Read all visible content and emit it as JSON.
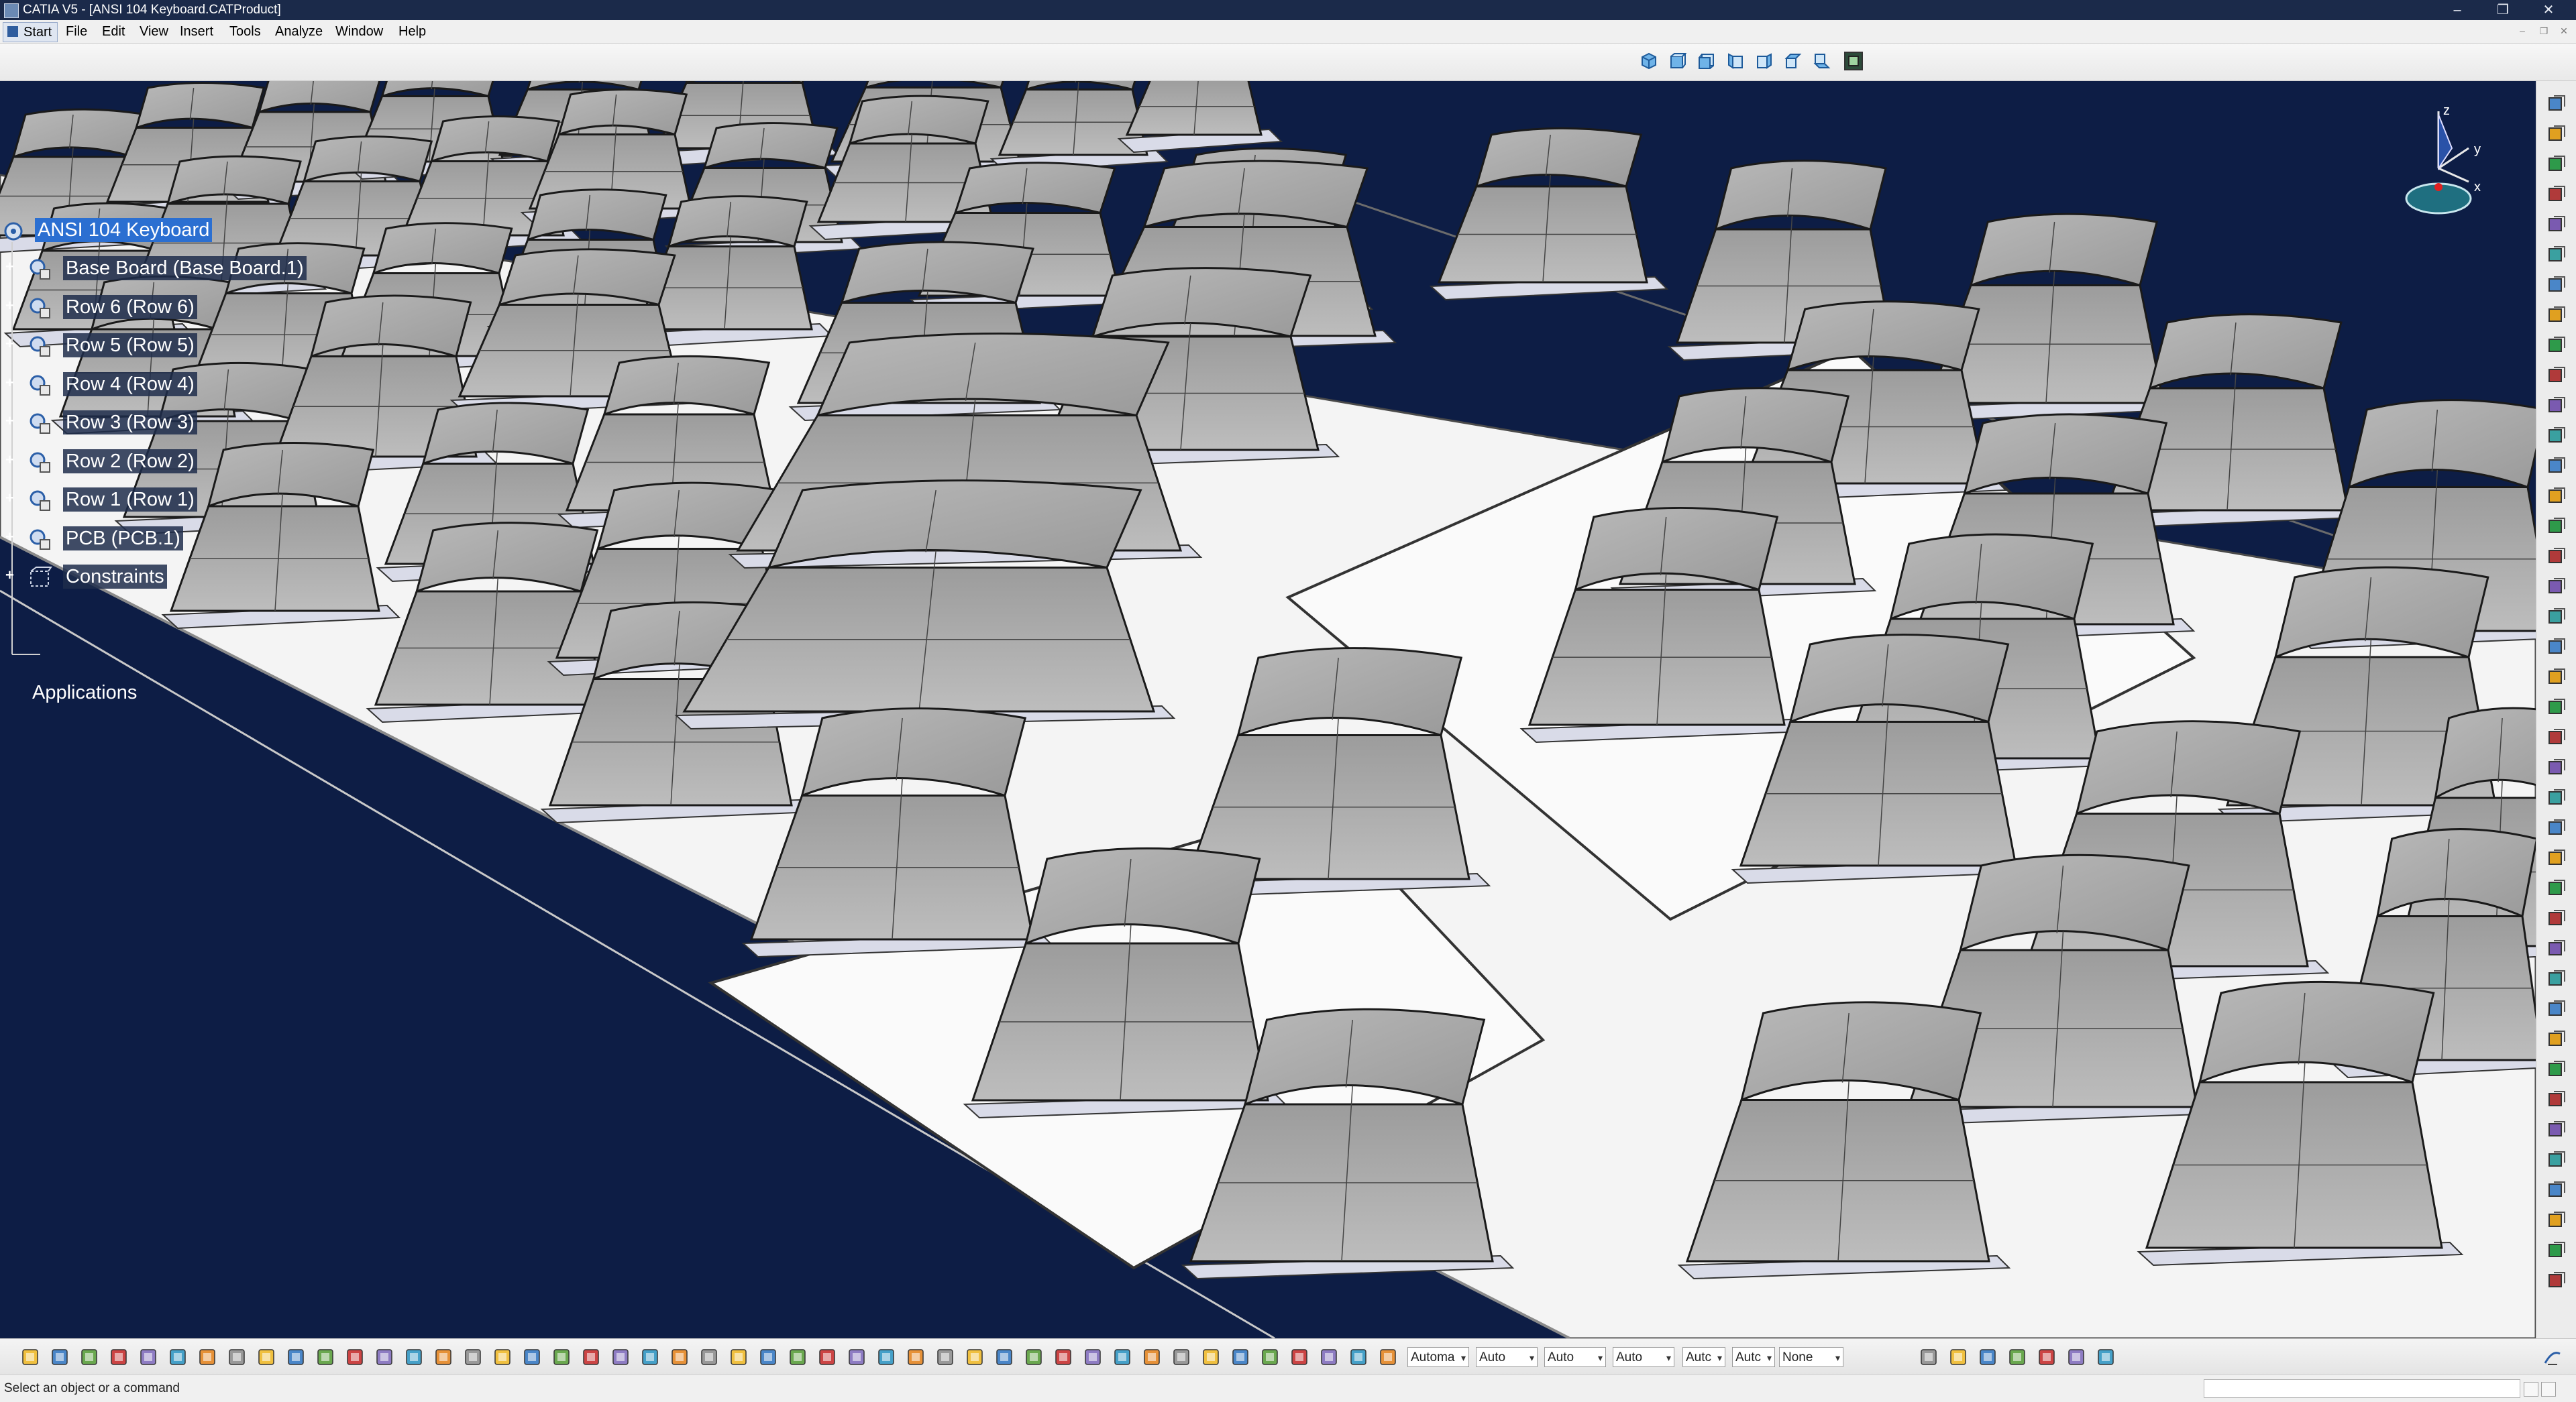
{
  "window": {
    "title": "CATIA V5 - [ANSI 104 Keyboard.CATProduct]",
    "controls": [
      "–",
      "❐",
      "✕"
    ]
  },
  "menu": {
    "start": "Start",
    "items": [
      "File",
      "Edit",
      "View",
      "Insert",
      "Tools",
      "Analyze",
      "Window",
      "Help"
    ],
    "mdi_controls": [
      "–",
      "❐",
      "✕"
    ]
  },
  "spec_tree": {
    "root": "ANSI 104 Keyboard",
    "nodes": [
      "Base Board (Base Board.1)",
      "Row 6 (Row 6)",
      "Row 5 (Row 5)",
      "Row 4 (Row 4)",
      "Row 3 (Row 3)",
      "Row 2 (Row 2)",
      "Row 1 (Row 1)",
      "PCB (PCB.1)",
      "Constraints"
    ],
    "applications": "Applications"
  },
  "compass": {
    "axes": [
      "z",
      "y",
      "x"
    ]
  },
  "bottom_toolbar": {
    "selects": [
      "Automa",
      "Auto",
      "Auto",
      "Auto",
      "Autc",
      "Autc",
      "None"
    ]
  },
  "status": {
    "text": "Select an object or a command"
  },
  "colors": {
    "viewport_bg": "#0d1d45",
    "keycap": "#a6a6a6",
    "baseboard": "#f4f4f4",
    "tree_highlight": "#2b6fd1"
  },
  "icons": {
    "view_toolbar": [
      "iso-view-icon",
      "front-view-icon",
      "back-view-icon",
      "left-view-icon",
      "right-view-icon",
      "top-view-icon",
      "bottom-view-icon",
      "named-views-icon"
    ],
    "right_toolbar_count": 40
  }
}
